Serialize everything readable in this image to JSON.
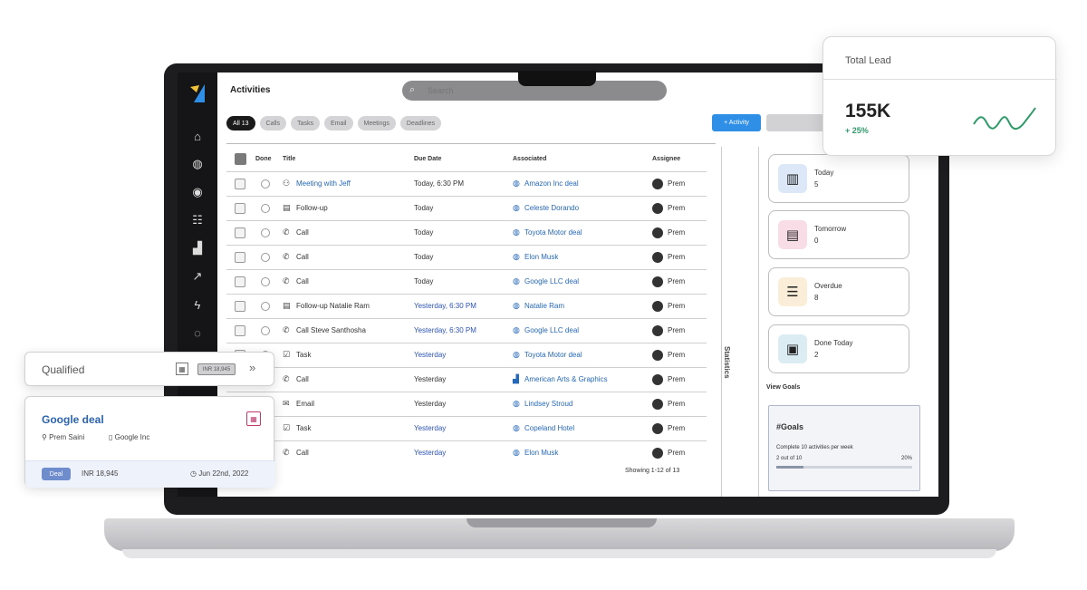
{
  "header": {
    "page_title": "Activities",
    "search_placeholder": "Search"
  },
  "filters": [
    {
      "label": "All 13",
      "active": true
    },
    {
      "label": "Calls",
      "active": false
    },
    {
      "label": "Tasks",
      "active": false
    },
    {
      "label": "Email",
      "active": false
    },
    {
      "label": "Meetings",
      "active": false
    },
    {
      "label": "Deadlines",
      "active": false
    }
  ],
  "add_button_label": "+ Activity",
  "table": {
    "headers": {
      "done": "Done",
      "title": "Title",
      "due_date": "Due Date",
      "associated": "Associated",
      "assignee": "Assignee"
    },
    "rows": [
      {
        "type_icon": "meeting-icon",
        "title": "Meeting with Jeff",
        "title_link": true,
        "due": "Today, 6:30 PM",
        "due_accent": false,
        "assoc_icon": "deal-icon",
        "associated": "Amazon Inc deal",
        "assignee": "Prem"
      },
      {
        "type_icon": "followup-icon",
        "title": "Follow-up",
        "title_link": false,
        "due": "Today",
        "due_accent": false,
        "assoc_icon": "deal-icon",
        "associated": "Celeste Dorando",
        "assignee": "Prem"
      },
      {
        "type_icon": "call-icon",
        "title": "Call",
        "title_link": false,
        "due": "Today",
        "due_accent": false,
        "assoc_icon": "deal-icon",
        "associated": "Toyota Motor deal",
        "assignee": "Prem"
      },
      {
        "type_icon": "call-icon",
        "title": "Call",
        "title_link": false,
        "due": "Today",
        "due_accent": false,
        "assoc_icon": "deal-icon",
        "associated": "Elon Musk",
        "assignee": "Prem"
      },
      {
        "type_icon": "call-icon",
        "title": "Call",
        "title_link": false,
        "due": "Today",
        "due_accent": false,
        "assoc_icon": "deal-icon",
        "associated": "Google LLC deal",
        "assignee": "Prem"
      },
      {
        "type_icon": "followup-icon",
        "title": "Follow-up Natalie Ram",
        "title_link": false,
        "due": "Yesterday, 6:30 PM",
        "due_accent": true,
        "assoc_icon": "deal-icon",
        "associated": "Natalie Ram",
        "assignee": "Prem"
      },
      {
        "type_icon": "call-icon",
        "title": "Call Steve Santhosha",
        "title_link": false,
        "due": "Yesterday, 6:30 PM",
        "due_accent": true,
        "assoc_icon": "deal-icon",
        "associated": "Google LLC deal",
        "assignee": "Prem"
      },
      {
        "type_icon": "task-icon",
        "title": "Task",
        "title_link": false,
        "due": "Yesterday",
        "due_accent": true,
        "assoc_icon": "deal-icon",
        "associated": "Toyota Motor deal",
        "assignee": "Prem"
      },
      {
        "type_icon": "call-icon",
        "title": "Call",
        "title_link": false,
        "due": "Yesterday",
        "due_accent": false,
        "assoc_icon": "company-icon",
        "associated": "American Arts & Graphics",
        "assignee": "Prem"
      },
      {
        "type_icon": "email-icon",
        "title": "Email",
        "title_link": false,
        "due": "Yesterday",
        "due_accent": false,
        "assoc_icon": "deal-icon",
        "associated": "Lindsey Stroud",
        "assignee": "Prem"
      },
      {
        "type_icon": "task-icon",
        "title": "Task",
        "title_link": false,
        "due": "Yesterday",
        "due_accent": true,
        "assoc_icon": "deal-icon",
        "associated": "Copeland Hotel",
        "assignee": "Prem"
      },
      {
        "type_icon": "call-icon",
        "title": "Call",
        "title_link": false,
        "due": "Yesterday",
        "due_accent": true,
        "assoc_icon": "deal-icon",
        "associated": "Elon Musk",
        "assignee": "Prem"
      }
    ],
    "showing": "Showing 1-12 of 13"
  },
  "statistics": {
    "label": "Statistics",
    "cards": [
      {
        "label": "Today",
        "count": "5",
        "icon": "calendar-icon",
        "color": "#dce8f8"
      },
      {
        "label": "Tomorrow",
        "count": "0",
        "icon": "clipboard-icon",
        "color": "#f8dde6"
      },
      {
        "label": "Overdue",
        "count": "8",
        "icon": "checklist-icon",
        "color": "#fbeed9"
      },
      {
        "label": "Done Today",
        "count": "2",
        "icon": "done-icon",
        "color": "#dcecf3"
      }
    ],
    "views_label": "View Goals",
    "goal": {
      "title": "#Goals",
      "description": "Complete 10 activities per week",
      "progress_text": "2 out of 10",
      "percent_text": "20%",
      "fraction": 0.2
    }
  },
  "total_lead": {
    "title": "Total Lead",
    "value": "155K",
    "change": "+ 25%",
    "change_color": "#2f9a6a"
  },
  "qualified": {
    "title": "Qualified",
    "badge": "INR 18,945"
  },
  "deal_card": {
    "title": "Google deal",
    "person": "Prem Saini",
    "company": "Google Inc",
    "tag": "Deal",
    "amount": "INR 18,945",
    "date": "Jun 22nd, 2022"
  },
  "colors": {
    "accent": "#2f8fe6",
    "sidebar": "#151517",
    "link": "#2668b8"
  }
}
